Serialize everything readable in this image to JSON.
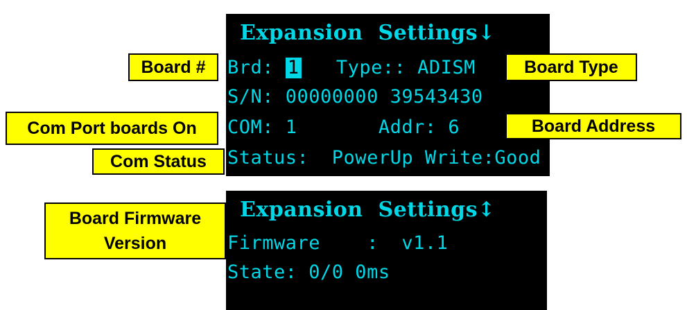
{
  "screen1": {
    "title": "Expansion  Settings↓",
    "brd_label": "Brd: ",
    "brd_value": "1",
    "type_text": "   Type:: ADISM",
    "sn_text": "S/N: 00000000 39543430",
    "com_text": "COM: 1       Addr: 6",
    "status_text": "Status:  PowerUp Write:Good"
  },
  "screen2": {
    "title": "Expansion  Settings↕",
    "firmware_text": "Firmware    :  v1.1",
    "state_text": "State: 0/0 0ms"
  },
  "annotations": {
    "board_number": "Board #",
    "board_type": "Board Type",
    "com_port_boards_on": "Com Port boards On",
    "board_address": "Board Address",
    "com_status": "Com Status",
    "board_firmware_line1": "Board Firmware",
    "board_firmware_line2": "Version"
  },
  "colors": {
    "screen_bg": "#000000",
    "screen_text": "#00d8e8",
    "annotation_bg": "#ffff00",
    "annotation_border": "#000000"
  }
}
